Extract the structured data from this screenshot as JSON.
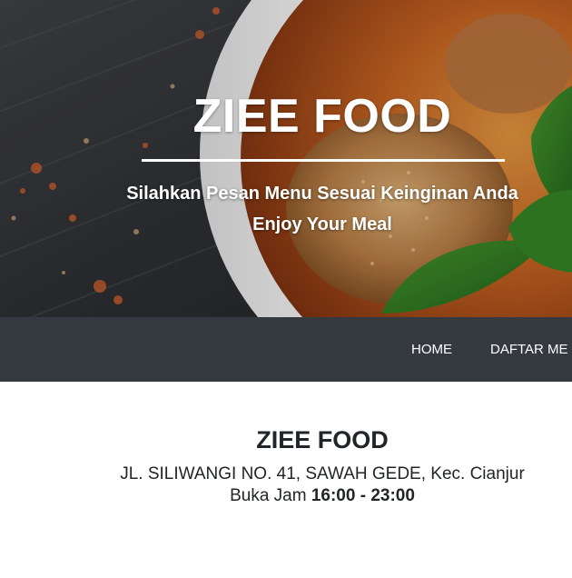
{
  "hero": {
    "title": "ZIEE FOOD",
    "tagline": "Silahkan Pesan Menu Sesuai Keinginan Anda",
    "subtitle": "Enjoy Your Meal",
    "background_image": "food-bowl-curry-photo"
  },
  "nav": {
    "items": [
      {
        "label": "HOME"
      },
      {
        "label": "DAFTAR ME"
      }
    ]
  },
  "info": {
    "title": "ZIEE FOOD",
    "address": "JL. SILIWANGI NO. 41, SAWAH GEDE, Kec. Cianjur",
    "hours_label": "Buka Jam",
    "hours_value": "16:00 - 23:00"
  },
  "colors": {
    "navbar_bg": "#343a40",
    "text_dark": "#212529",
    "hero_text": "#ffffff"
  }
}
